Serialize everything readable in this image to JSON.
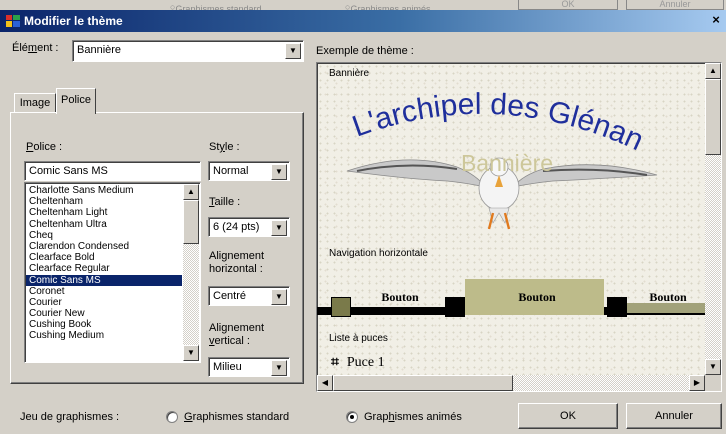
{
  "dialog": {
    "title": "Modifier le thème",
    "close_glyph": "×"
  },
  "background_window": {
    "ok_label": "OK",
    "cancel_label": "Annuler",
    "option1": "Graphismes standard",
    "option2": "Graphismes animés"
  },
  "element_select": {
    "label_pre": "Élé",
    "label_u": "m",
    "label_post": "ent :",
    "value": "Bannière"
  },
  "tabs": [
    {
      "label": "Image",
      "active": false
    },
    {
      "label": "Police",
      "active": true
    }
  ],
  "font_panel": {
    "font_label_u": "P",
    "font_label_rest": "olice :",
    "font_value": "Comic Sans MS",
    "fonts": [
      "Charlotte Sans Medium",
      "Cheltenham",
      "Cheltenham Light",
      "Cheltenham Ultra",
      "Cheq",
      "Clarendon Condensed",
      "Clearface Bold",
      "Clearface Regular",
      "Comic Sans MS",
      "Coronet",
      "Courier",
      "Courier New",
      "Cushing Book",
      "Cushing Medium"
    ],
    "selected_font": "Comic Sans MS",
    "style_label_pre": "St",
    "style_label_u": "y",
    "style_label_post": "le :",
    "style_value": "Normal",
    "size_label_u": "T",
    "size_label_rest": "aille :",
    "size_value": "6  (24 pts)",
    "halign_label_1": "Alignement",
    "halign_label_2": "horizontal :",
    "halign_value": "Centré",
    "valign_label_1": "Alignement",
    "valign_label_u": "v",
    "valign_label_2_rest": "ertical :",
    "valign_value": "Milieu"
  },
  "preview": {
    "label_pre": "Exemple de thème :",
    "section_banner": "Bannière",
    "banner_title": "L'archipel des Glénan",
    "banner_subtitle": "Bannière",
    "section_nav": "Navigation horizontale",
    "nav_buttons": [
      "Bouton",
      "Bouton",
      "Bouton"
    ],
    "section_list": "Liste à puces",
    "bullet_glyph": "⌗",
    "bullet_item": "Puce 1"
  },
  "footer": {
    "label": "Jeu de graphismes :",
    "radio_standard_u": "G",
    "radio_standard_rest": "raphismes standard",
    "radio_animated_pre": "Grap",
    "radio_animated_u": "h",
    "radio_animated_post": "ismes animés",
    "selected": "animated",
    "ok_label": "OK",
    "cancel_label": "Annuler"
  },
  "colors": {
    "title_start": "#0a246a",
    "title_end": "#a6caf0",
    "selection": "#0a246a",
    "banner_title": "#1f2f9c",
    "banner_subtitle": "#cdc79a",
    "nav_highlight": "#bdbb8a",
    "nav_bar": "#000000"
  }
}
